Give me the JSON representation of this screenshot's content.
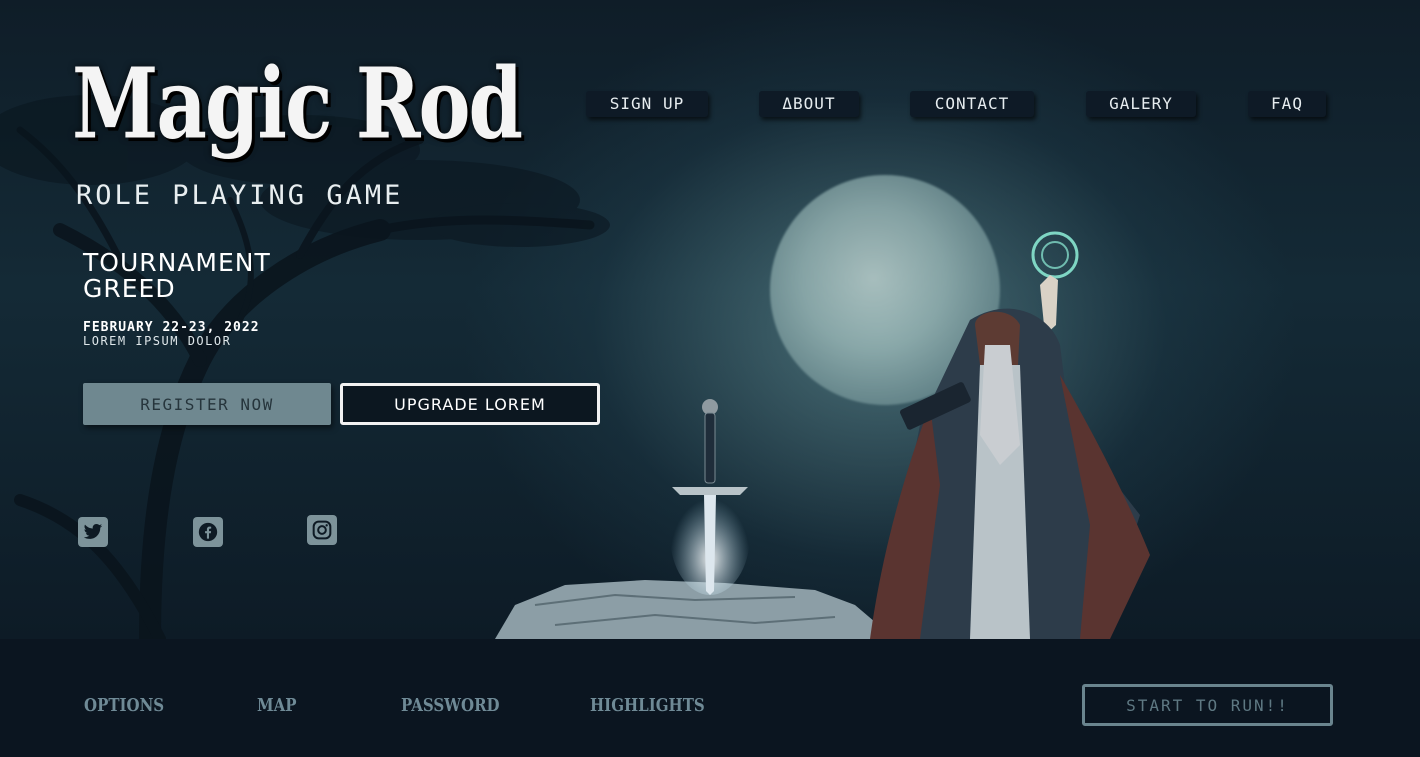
{
  "logo": {
    "title": "Magic Rod",
    "subtitle": "ROLE PLAYING GAME"
  },
  "nav": {
    "items": [
      {
        "label": "SIGN UP"
      },
      {
        "label": "ΔBOUT"
      },
      {
        "label": "CONTACT"
      },
      {
        "label": "GALERY"
      },
      {
        "label": "FAQ"
      }
    ]
  },
  "event": {
    "title_line1": "TOURNAMENT",
    "title_line2": "GREED",
    "date": "FEBRUARY 22-23, 2022",
    "subtitle": "LOREM IPSUM DOLOR"
  },
  "buttons": {
    "register": "REGISTER NOW",
    "upgrade": "UPGRADE LOREM"
  },
  "social": [
    {
      "icon": "twitter-icon"
    },
    {
      "icon": "facebook-icon"
    },
    {
      "icon": "instagram-icon"
    }
  ],
  "footer": {
    "links": [
      {
        "label": "OPTIONS"
      },
      {
        "label": "MAP"
      },
      {
        "label": "PASSWORD"
      },
      {
        "label": "HIGHLIGHTS"
      }
    ],
    "start_button": "START TO RUN!!"
  },
  "colors": {
    "background": "#0d1722",
    "footer": "#0b1520",
    "register_button": "#6f8890",
    "footer_link": "#6f8a96"
  }
}
